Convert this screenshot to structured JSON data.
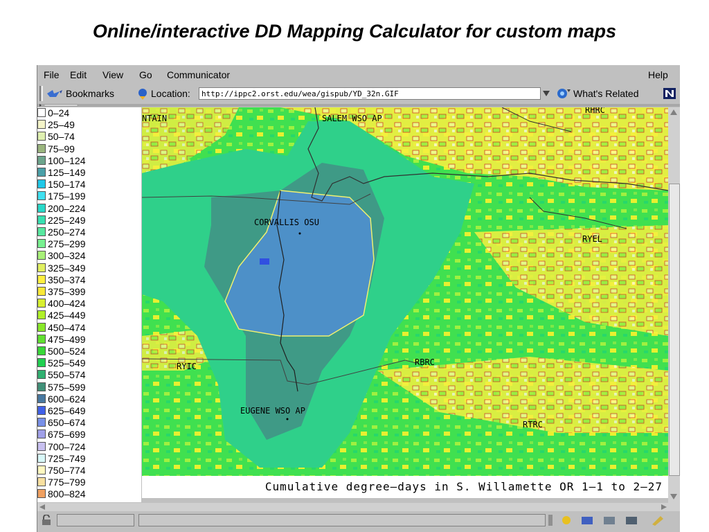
{
  "slide_title": "Online/interactive DD Mapping Calculator for custom maps",
  "menubar": {
    "items": [
      "File",
      "Edit",
      "View",
      "Go",
      "Communicator"
    ],
    "help": "Help"
  },
  "locbar": {
    "bookmarks_label": "Bookmarks",
    "location_label": "Location:",
    "url": "http://ippc2.orst.edu/wea/gispub/YD_32n.GIF",
    "related_label": "What's Related"
  },
  "legend": [
    {
      "label": "0–24",
      "color": "#ffffff"
    },
    {
      "label": "25–49",
      "color": "#f4f4c8"
    },
    {
      "label": "50–74",
      "color": "#dff0b0"
    },
    {
      "label": "75–99",
      "color": "#9ab57e"
    },
    {
      "label": "100–124",
      "color": "#6ca58c"
    },
    {
      "label": "125–149",
      "color": "#4aa0a8"
    },
    {
      "label": "150–174",
      "color": "#20c8e8"
    },
    {
      "label": "175–199",
      "color": "#3fe0f0"
    },
    {
      "label": "200–224",
      "color": "#28d8c8"
    },
    {
      "label": "225–249",
      "color": "#38e0b0"
    },
    {
      "label": "250–274",
      "color": "#58e8a0"
    },
    {
      "label": "275–299",
      "color": "#78f090"
    },
    {
      "label": "300–324",
      "color": "#a8f078"
    },
    {
      "label": "325–349",
      "color": "#e0f060"
    },
    {
      "label": "350–374",
      "color": "#fff040"
    },
    {
      "label": "375–399",
      "color": "#f8e838"
    },
    {
      "label": "400–424",
      "color": "#d8f030"
    },
    {
      "label": "425–449",
      "color": "#b0f028"
    },
    {
      "label": "450–474",
      "color": "#88e828"
    },
    {
      "label": "475–499",
      "color": "#60e030"
    },
    {
      "label": "500–524",
      "color": "#38d838"
    },
    {
      "label": "525–549",
      "color": "#20d050"
    },
    {
      "label": "550–574",
      "color": "#30b070"
    },
    {
      "label": "575–599",
      "color": "#409078"
    },
    {
      "label": "600–624",
      "color": "#4878a0"
    },
    {
      "label": "625–649",
      "color": "#4060e8"
    },
    {
      "label": "650–674",
      "color": "#7890e8"
    },
    {
      "label": "675–699",
      "color": "#a0a0e8"
    },
    {
      "label": "700–724",
      "color": "#c8c0f0"
    },
    {
      "label": "725–749",
      "color": "#d8f8f8"
    },
    {
      "label": "750–774",
      "color": "#fff8c0"
    },
    {
      "label": "775–799",
      "color": "#f8e0a0"
    },
    {
      "label": "800–824",
      "color": "#f0a060"
    }
  ],
  "map": {
    "labels": [
      "NTAIN",
      "SALEM WSO AP",
      "RHRC",
      "CORVALLIS OSU",
      "RYEL",
      "RYIC",
      "RBRC",
      "EUGENE WSO AP",
      "RTRC"
    ],
    "caption": "Cumulative degree–days in S. Willamette OR 1–1 to 2–27"
  }
}
